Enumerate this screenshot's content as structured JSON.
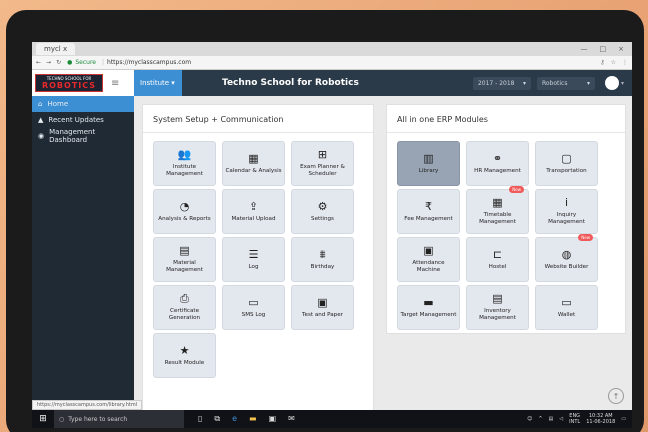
{
  "browser": {
    "tab_title": "mycl x",
    "window_controls": [
      "—",
      "□",
      "×"
    ],
    "secure_label": "Secure",
    "url": "https://myclasscampus.com"
  },
  "header": {
    "logo_top": "TECHNO SCHOOL FOR",
    "logo_main": "ROBOTICS",
    "institute_dropdown": "Institute ▾",
    "school_name": "Techno School for Robotics",
    "year_select": "2017 - 2018",
    "branch_select": "Robotics"
  },
  "sidebar": {
    "items": [
      {
        "label": "Home"
      },
      {
        "label": "Recent Updates"
      },
      {
        "label": "Management Dashboard"
      }
    ]
  },
  "panel_setup": {
    "title": "System Setup + Communication",
    "tiles": [
      {
        "label": "Institute Management",
        "icon": "users-icon"
      },
      {
        "label": "Calendar & Analysis",
        "icon": "calendar-icon"
      },
      {
        "label": "Exam Planner & Scheduler",
        "icon": "calendar-plus-icon"
      },
      {
        "label": "Analysis & Reports",
        "icon": "pie-chart-icon"
      },
      {
        "label": "Material Upload",
        "icon": "upload-icon"
      },
      {
        "label": "Settings",
        "icon": "gears-icon"
      },
      {
        "label": "Material Management",
        "icon": "file-icon"
      },
      {
        "label": "Log",
        "icon": "log-icon"
      },
      {
        "label": "Birthday",
        "icon": "birthday-cake-icon"
      },
      {
        "label": "Certificate Generation",
        "icon": "printer-icon"
      },
      {
        "label": "SMS Log",
        "icon": "inbox-icon"
      },
      {
        "label": "Test and Paper",
        "icon": "id-card-icon"
      },
      {
        "label": "Result Module",
        "icon": "star-icon"
      }
    ]
  },
  "panel_erp": {
    "title": "All in one ERP Modules",
    "tiles": [
      {
        "label": "Library",
        "icon": "book-icon"
      },
      {
        "label": "HR Management",
        "icon": "handshake-icon"
      },
      {
        "label": "Transportation",
        "icon": "bus-icon"
      },
      {
        "label": "Fee Management",
        "icon": "rupee-icon"
      },
      {
        "label": "Timetable Management",
        "icon": "timetable-icon",
        "badge": "New"
      },
      {
        "label": "Inquiry Management",
        "icon": "info-icon"
      },
      {
        "label": "Attendance Machine",
        "icon": "attendance-icon"
      },
      {
        "label": "Hostel",
        "icon": "bed-icon"
      },
      {
        "label": "Website Builder",
        "icon": "globe-icon",
        "badge": "New"
      },
      {
        "label": "Target Management",
        "icon": "archive-icon"
      },
      {
        "label": "Inventory Management",
        "icon": "clipboard-icon"
      },
      {
        "label": "Wallet",
        "icon": "wallet-icon"
      }
    ]
  },
  "status_url": "https://myclasscampus.com/library.html",
  "taskbar": {
    "search_placeholder": "Type here to search",
    "lang_top": "ENG",
    "lang_bottom": "INTL",
    "time": "10:32 AM",
    "date": "11-06-2018"
  }
}
